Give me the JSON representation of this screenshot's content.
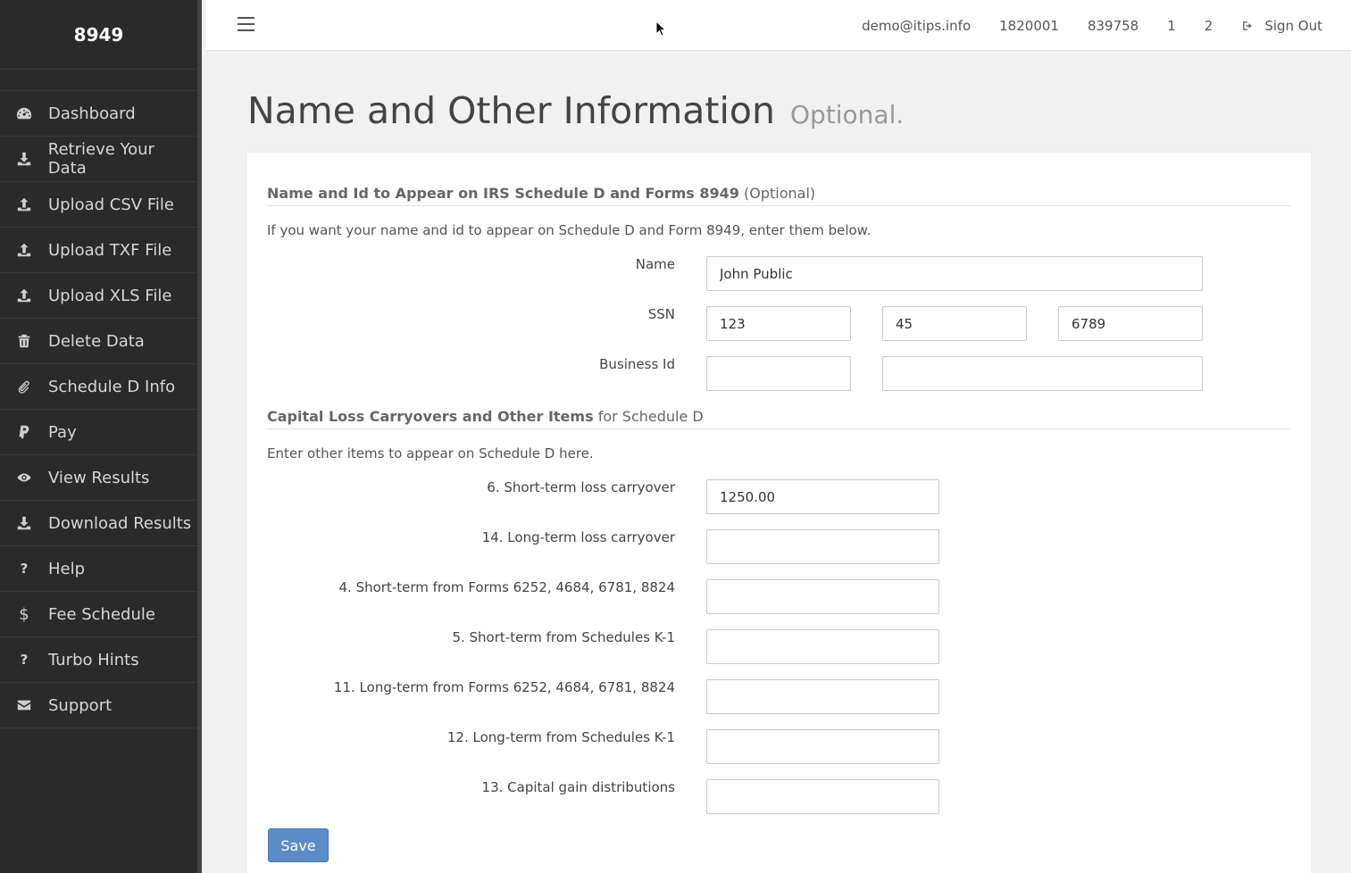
{
  "sidebar": {
    "brand": "8949",
    "items": [
      {
        "label": "Dashboard",
        "icon": "dashboard-icon"
      },
      {
        "label": "Retrieve Your Data",
        "icon": "download-icon"
      },
      {
        "label": "Upload CSV File",
        "icon": "upload-icon"
      },
      {
        "label": "Upload TXF File",
        "icon": "upload-icon"
      },
      {
        "label": "Upload XLS File",
        "icon": "upload-icon"
      },
      {
        "label": "Delete Data",
        "icon": "trash-icon"
      },
      {
        "label": "Schedule D Info",
        "icon": "paperclip-icon"
      },
      {
        "label": "Pay",
        "icon": "paypal-icon"
      },
      {
        "label": "View Results",
        "icon": "eye-icon"
      },
      {
        "label": "Download Results",
        "icon": "download-icon"
      },
      {
        "label": "Help",
        "icon": "question-icon"
      },
      {
        "label": "Fee Schedule",
        "icon": "dollar-icon"
      },
      {
        "label": "Turbo Hints",
        "icon": "question-icon"
      },
      {
        "label": "Support",
        "icon": "envelope-icon"
      }
    ]
  },
  "topbar": {
    "email": "demo@itips.info",
    "id1": "1820001",
    "id2": "839758",
    "n1": "1",
    "n2": "2",
    "signout": "Sign Out"
  },
  "page": {
    "title": "Name and Other Information",
    "subtitle": "Optional."
  },
  "section1": {
    "title_bold": "Name and Id to Appear on IRS Schedule D and Forms 8949",
    "title_rest": "(Optional)",
    "intro": "If you want your name and id to appear on Schedule D and Form 8949, enter them below.",
    "name_label": "Name",
    "name_value": "John Public",
    "ssn_label": "SSN",
    "ssn1": "123",
    "ssn2": "45",
    "ssn3": "6789",
    "bizid_label": "Business Id",
    "bizid1": "",
    "bizid2": ""
  },
  "section2": {
    "title_bold": "Capital Loss Carryovers and Other Items",
    "title_rest": "for Schedule D",
    "intro": "Enter other items to appear on Schedule D here.",
    "fields": [
      {
        "label": "6. Short-term loss carryover",
        "value": "1250.00"
      },
      {
        "label": "14. Long-term loss carryover",
        "value": ""
      },
      {
        "label": "4. Short-term from Forms 6252, 4684, 6781, 8824",
        "value": ""
      },
      {
        "label": "5. Short-term from Schedules K-1",
        "value": ""
      },
      {
        "label": "11. Long-term from Forms 6252, 4684, 6781, 8824",
        "value": ""
      },
      {
        "label": "12. Long-term from Schedules K-1",
        "value": ""
      },
      {
        "label": "13. Capital gain distributions",
        "value": ""
      }
    ]
  },
  "save_label": "Save"
}
